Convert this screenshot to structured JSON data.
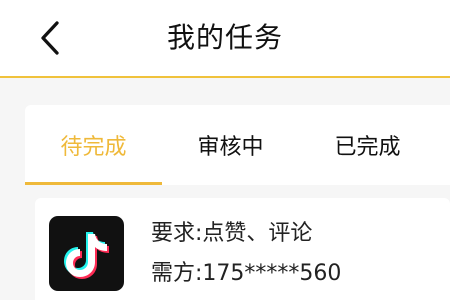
{
  "header": {
    "title": "我的任务",
    "back_icon": "chevron-left-icon"
  },
  "tabs": [
    {
      "label": "待完成",
      "active": true
    },
    {
      "label": "审核中",
      "active": false
    },
    {
      "label": "已完成",
      "active": false
    }
  ],
  "task": {
    "icon": "tiktok-icon",
    "requirement": "要求:点赞、评论",
    "client": "需方:175*****560"
  },
  "colors": {
    "accent": "#efb93a",
    "header_border": "#f0c23c",
    "background": "#f6f6f6",
    "card": "#ffffff"
  }
}
